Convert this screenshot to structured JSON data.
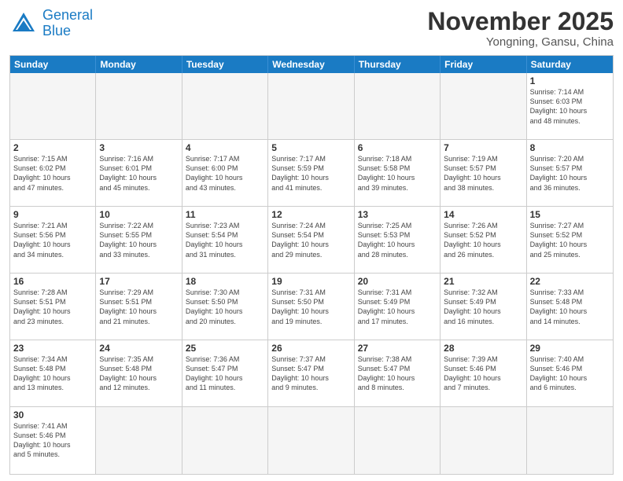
{
  "logo": {
    "line1": "General",
    "line2": "Blue"
  },
  "title": "November 2025",
  "subtitle": "Yongning, Gansu, China",
  "days": [
    "Sunday",
    "Monday",
    "Tuesday",
    "Wednesday",
    "Thursday",
    "Friday",
    "Saturday"
  ],
  "cells": [
    {
      "day": "",
      "info": ""
    },
    {
      "day": "",
      "info": ""
    },
    {
      "day": "",
      "info": ""
    },
    {
      "day": "",
      "info": ""
    },
    {
      "day": "",
      "info": ""
    },
    {
      "day": "",
      "info": ""
    },
    {
      "day": "1",
      "info": "Sunrise: 7:14 AM\nSunset: 6:03 PM\nDaylight: 10 hours\nand 48 minutes."
    },
    {
      "day": "2",
      "info": "Sunrise: 7:15 AM\nSunset: 6:02 PM\nDaylight: 10 hours\nand 47 minutes."
    },
    {
      "day": "3",
      "info": "Sunrise: 7:16 AM\nSunset: 6:01 PM\nDaylight: 10 hours\nand 45 minutes."
    },
    {
      "day": "4",
      "info": "Sunrise: 7:17 AM\nSunset: 6:00 PM\nDaylight: 10 hours\nand 43 minutes."
    },
    {
      "day": "5",
      "info": "Sunrise: 7:17 AM\nSunset: 5:59 PM\nDaylight: 10 hours\nand 41 minutes."
    },
    {
      "day": "6",
      "info": "Sunrise: 7:18 AM\nSunset: 5:58 PM\nDaylight: 10 hours\nand 39 minutes."
    },
    {
      "day": "7",
      "info": "Sunrise: 7:19 AM\nSunset: 5:57 PM\nDaylight: 10 hours\nand 38 minutes."
    },
    {
      "day": "8",
      "info": "Sunrise: 7:20 AM\nSunset: 5:57 PM\nDaylight: 10 hours\nand 36 minutes."
    },
    {
      "day": "9",
      "info": "Sunrise: 7:21 AM\nSunset: 5:56 PM\nDaylight: 10 hours\nand 34 minutes."
    },
    {
      "day": "10",
      "info": "Sunrise: 7:22 AM\nSunset: 5:55 PM\nDaylight: 10 hours\nand 33 minutes."
    },
    {
      "day": "11",
      "info": "Sunrise: 7:23 AM\nSunset: 5:54 PM\nDaylight: 10 hours\nand 31 minutes."
    },
    {
      "day": "12",
      "info": "Sunrise: 7:24 AM\nSunset: 5:54 PM\nDaylight: 10 hours\nand 29 minutes."
    },
    {
      "day": "13",
      "info": "Sunrise: 7:25 AM\nSunset: 5:53 PM\nDaylight: 10 hours\nand 28 minutes."
    },
    {
      "day": "14",
      "info": "Sunrise: 7:26 AM\nSunset: 5:52 PM\nDaylight: 10 hours\nand 26 minutes."
    },
    {
      "day": "15",
      "info": "Sunrise: 7:27 AM\nSunset: 5:52 PM\nDaylight: 10 hours\nand 25 minutes."
    },
    {
      "day": "16",
      "info": "Sunrise: 7:28 AM\nSunset: 5:51 PM\nDaylight: 10 hours\nand 23 minutes."
    },
    {
      "day": "17",
      "info": "Sunrise: 7:29 AM\nSunset: 5:51 PM\nDaylight: 10 hours\nand 21 minutes."
    },
    {
      "day": "18",
      "info": "Sunrise: 7:30 AM\nSunset: 5:50 PM\nDaylight: 10 hours\nand 20 minutes."
    },
    {
      "day": "19",
      "info": "Sunrise: 7:31 AM\nSunset: 5:50 PM\nDaylight: 10 hours\nand 19 minutes."
    },
    {
      "day": "20",
      "info": "Sunrise: 7:31 AM\nSunset: 5:49 PM\nDaylight: 10 hours\nand 17 minutes."
    },
    {
      "day": "21",
      "info": "Sunrise: 7:32 AM\nSunset: 5:49 PM\nDaylight: 10 hours\nand 16 minutes."
    },
    {
      "day": "22",
      "info": "Sunrise: 7:33 AM\nSunset: 5:48 PM\nDaylight: 10 hours\nand 14 minutes."
    },
    {
      "day": "23",
      "info": "Sunrise: 7:34 AM\nSunset: 5:48 PM\nDaylight: 10 hours\nand 13 minutes."
    },
    {
      "day": "24",
      "info": "Sunrise: 7:35 AM\nSunset: 5:48 PM\nDaylight: 10 hours\nand 12 minutes."
    },
    {
      "day": "25",
      "info": "Sunrise: 7:36 AM\nSunset: 5:47 PM\nDaylight: 10 hours\nand 11 minutes."
    },
    {
      "day": "26",
      "info": "Sunrise: 7:37 AM\nSunset: 5:47 PM\nDaylight: 10 hours\nand 9 minutes."
    },
    {
      "day": "27",
      "info": "Sunrise: 7:38 AM\nSunset: 5:47 PM\nDaylight: 10 hours\nand 8 minutes."
    },
    {
      "day": "28",
      "info": "Sunrise: 7:39 AM\nSunset: 5:46 PM\nDaylight: 10 hours\nand 7 minutes."
    },
    {
      "day": "29",
      "info": "Sunrise: 7:40 AM\nSunset: 5:46 PM\nDaylight: 10 hours\nand 6 minutes."
    },
    {
      "day": "30",
      "info": "Sunrise: 7:41 AM\nSunset: 5:46 PM\nDaylight: 10 hours\nand 5 minutes."
    },
    {
      "day": "",
      "info": ""
    },
    {
      "day": "",
      "info": ""
    },
    {
      "day": "",
      "info": ""
    },
    {
      "day": "",
      "info": ""
    },
    {
      "day": "",
      "info": ""
    },
    {
      "day": "",
      "info": ""
    }
  ]
}
